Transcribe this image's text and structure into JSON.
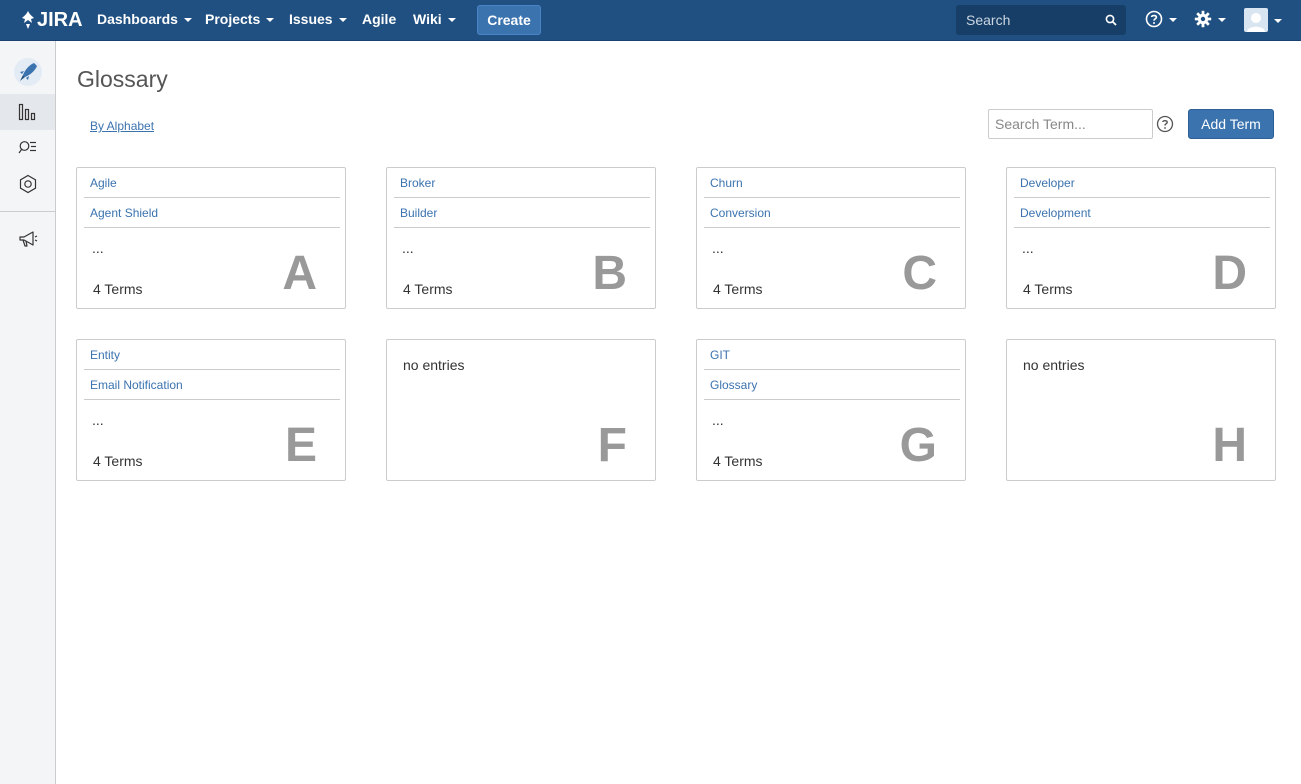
{
  "topnav": {
    "logo": "JIRA",
    "items": [
      {
        "label": "Dashboards",
        "dropdown": true
      },
      {
        "label": "Projects",
        "dropdown": true
      },
      {
        "label": "Issues",
        "dropdown": true
      },
      {
        "label": "Agile",
        "dropdown": false
      },
      {
        "label": "Wiki",
        "dropdown": true
      }
    ],
    "create_label": "Create",
    "search_placeholder": "Search",
    "colors": {
      "bar": "#205081",
      "create": "#3b73af"
    }
  },
  "sidebar": {
    "items": [
      {
        "icon": "rocket-icon"
      },
      {
        "icon": "bar-chart-icon",
        "active": true
      },
      {
        "icon": "search-list-icon"
      },
      {
        "icon": "hexagon-icon"
      },
      {
        "icon": "megaphone-icon"
      }
    ]
  },
  "main": {
    "title": "Glossary",
    "view_link": "By Alphabet",
    "search_placeholder": "Search Term...",
    "add_term_label": "Add Term"
  },
  "cards": [
    {
      "letter": "A",
      "terms": [
        "Agile",
        "Agent Shield"
      ],
      "more": "...",
      "count": "4 Terms",
      "empty": false
    },
    {
      "letter": "B",
      "terms": [
        "Broker",
        "Builder"
      ],
      "more": "...",
      "count": "4 Terms",
      "empty": false
    },
    {
      "letter": "C",
      "terms": [
        "Churn",
        "Conversion"
      ],
      "more": "...",
      "count": "4 Terms",
      "empty": false
    },
    {
      "letter": "D",
      "terms": [
        "Developer",
        "Development"
      ],
      "more": "...",
      "count": "4 Terms",
      "empty": false
    },
    {
      "letter": "E",
      "terms": [
        "Entity",
        "Email Notification"
      ],
      "more": "...",
      "count": "4 Terms",
      "empty": false
    },
    {
      "letter": "F",
      "terms": [],
      "empty_text": "no entries",
      "empty": true
    },
    {
      "letter": "G",
      "terms": [
        "GIT",
        "Glossary"
      ],
      "more": "...",
      "count": "4 Terms",
      "empty": false
    },
    {
      "letter": "H",
      "terms": [],
      "empty_text": "no entries",
      "empty": true
    }
  ]
}
